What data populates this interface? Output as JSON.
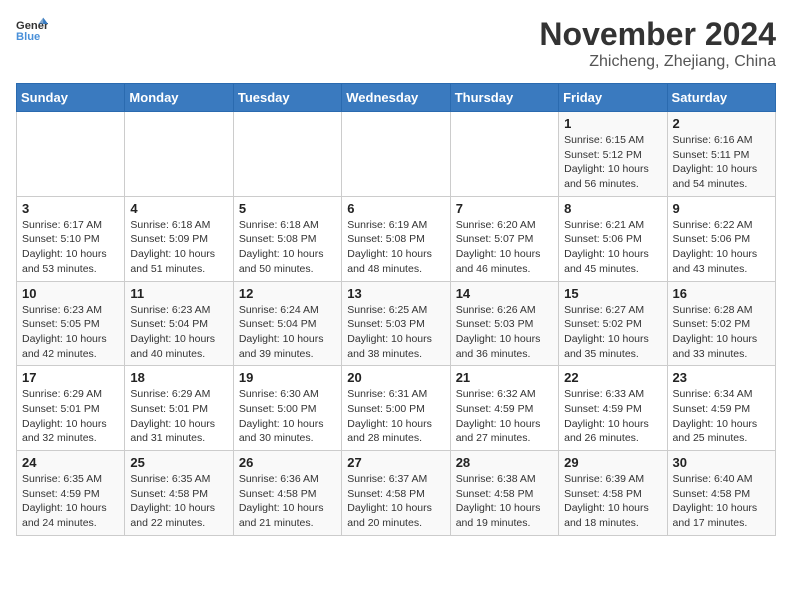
{
  "header": {
    "logo_general": "General",
    "logo_blue": "Blue",
    "month_title": "November 2024",
    "location": "Zhicheng, Zhejiang, China"
  },
  "weekdays": [
    "Sunday",
    "Monday",
    "Tuesday",
    "Wednesday",
    "Thursday",
    "Friday",
    "Saturday"
  ],
  "weeks": [
    [
      {
        "day": "",
        "info": ""
      },
      {
        "day": "",
        "info": ""
      },
      {
        "day": "",
        "info": ""
      },
      {
        "day": "",
        "info": ""
      },
      {
        "day": "",
        "info": ""
      },
      {
        "day": "1",
        "info": "Sunrise: 6:15 AM\nSunset: 5:12 PM\nDaylight: 10 hours and 56 minutes."
      },
      {
        "day": "2",
        "info": "Sunrise: 6:16 AM\nSunset: 5:11 PM\nDaylight: 10 hours and 54 minutes."
      }
    ],
    [
      {
        "day": "3",
        "info": "Sunrise: 6:17 AM\nSunset: 5:10 PM\nDaylight: 10 hours and 53 minutes."
      },
      {
        "day": "4",
        "info": "Sunrise: 6:18 AM\nSunset: 5:09 PM\nDaylight: 10 hours and 51 minutes."
      },
      {
        "day": "5",
        "info": "Sunrise: 6:18 AM\nSunset: 5:08 PM\nDaylight: 10 hours and 50 minutes."
      },
      {
        "day": "6",
        "info": "Sunrise: 6:19 AM\nSunset: 5:08 PM\nDaylight: 10 hours and 48 minutes."
      },
      {
        "day": "7",
        "info": "Sunrise: 6:20 AM\nSunset: 5:07 PM\nDaylight: 10 hours and 46 minutes."
      },
      {
        "day": "8",
        "info": "Sunrise: 6:21 AM\nSunset: 5:06 PM\nDaylight: 10 hours and 45 minutes."
      },
      {
        "day": "9",
        "info": "Sunrise: 6:22 AM\nSunset: 5:06 PM\nDaylight: 10 hours and 43 minutes."
      }
    ],
    [
      {
        "day": "10",
        "info": "Sunrise: 6:23 AM\nSunset: 5:05 PM\nDaylight: 10 hours and 42 minutes."
      },
      {
        "day": "11",
        "info": "Sunrise: 6:23 AM\nSunset: 5:04 PM\nDaylight: 10 hours and 40 minutes."
      },
      {
        "day": "12",
        "info": "Sunrise: 6:24 AM\nSunset: 5:04 PM\nDaylight: 10 hours and 39 minutes."
      },
      {
        "day": "13",
        "info": "Sunrise: 6:25 AM\nSunset: 5:03 PM\nDaylight: 10 hours and 38 minutes."
      },
      {
        "day": "14",
        "info": "Sunrise: 6:26 AM\nSunset: 5:03 PM\nDaylight: 10 hours and 36 minutes."
      },
      {
        "day": "15",
        "info": "Sunrise: 6:27 AM\nSunset: 5:02 PM\nDaylight: 10 hours and 35 minutes."
      },
      {
        "day": "16",
        "info": "Sunrise: 6:28 AM\nSunset: 5:02 PM\nDaylight: 10 hours and 33 minutes."
      }
    ],
    [
      {
        "day": "17",
        "info": "Sunrise: 6:29 AM\nSunset: 5:01 PM\nDaylight: 10 hours and 32 minutes."
      },
      {
        "day": "18",
        "info": "Sunrise: 6:29 AM\nSunset: 5:01 PM\nDaylight: 10 hours and 31 minutes."
      },
      {
        "day": "19",
        "info": "Sunrise: 6:30 AM\nSunset: 5:00 PM\nDaylight: 10 hours and 30 minutes."
      },
      {
        "day": "20",
        "info": "Sunrise: 6:31 AM\nSunset: 5:00 PM\nDaylight: 10 hours and 28 minutes."
      },
      {
        "day": "21",
        "info": "Sunrise: 6:32 AM\nSunset: 4:59 PM\nDaylight: 10 hours and 27 minutes."
      },
      {
        "day": "22",
        "info": "Sunrise: 6:33 AM\nSunset: 4:59 PM\nDaylight: 10 hours and 26 minutes."
      },
      {
        "day": "23",
        "info": "Sunrise: 6:34 AM\nSunset: 4:59 PM\nDaylight: 10 hours and 25 minutes."
      }
    ],
    [
      {
        "day": "24",
        "info": "Sunrise: 6:35 AM\nSunset: 4:59 PM\nDaylight: 10 hours and 24 minutes."
      },
      {
        "day": "25",
        "info": "Sunrise: 6:35 AM\nSunset: 4:58 PM\nDaylight: 10 hours and 22 minutes."
      },
      {
        "day": "26",
        "info": "Sunrise: 6:36 AM\nSunset: 4:58 PM\nDaylight: 10 hours and 21 minutes."
      },
      {
        "day": "27",
        "info": "Sunrise: 6:37 AM\nSunset: 4:58 PM\nDaylight: 10 hours and 20 minutes."
      },
      {
        "day": "28",
        "info": "Sunrise: 6:38 AM\nSunset: 4:58 PM\nDaylight: 10 hours and 19 minutes."
      },
      {
        "day": "29",
        "info": "Sunrise: 6:39 AM\nSunset: 4:58 PM\nDaylight: 10 hours and 18 minutes."
      },
      {
        "day": "30",
        "info": "Sunrise: 6:40 AM\nSunset: 4:58 PM\nDaylight: 10 hours and 17 minutes."
      }
    ]
  ]
}
